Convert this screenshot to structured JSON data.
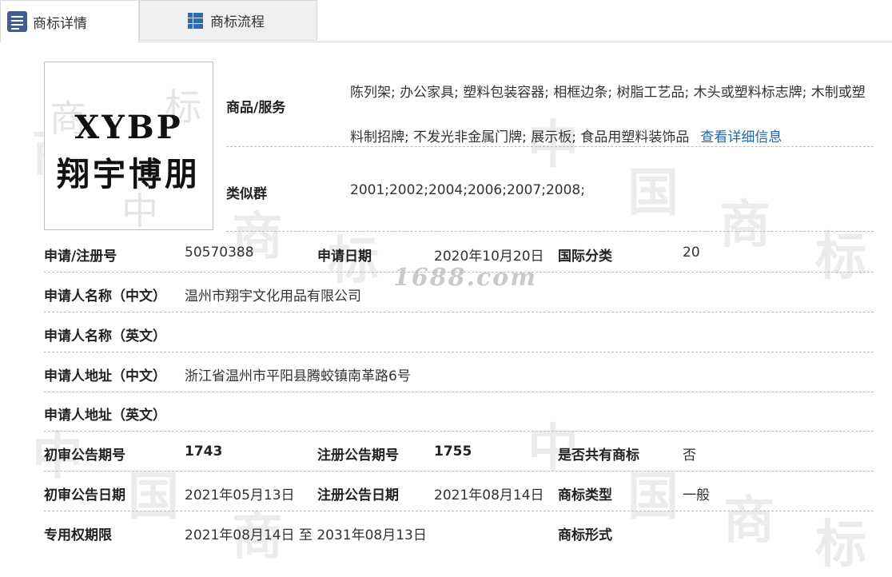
{
  "tabs": [
    {
      "label": "商标详情",
      "icon": "document-list-icon",
      "active": true
    },
    {
      "label": "商标流程",
      "icon": "grid-table-icon",
      "active": false
    }
  ],
  "logo": {
    "text_en": "XYBP",
    "text_cn": "翔宇博朋"
  },
  "watermark": {
    "center_text": "1688.com"
  },
  "goods": {
    "label": "商品/服务",
    "value": "陈列架; 办公家具; 塑料包装容器; 相框边条; 树脂工艺品; 木头或塑料标志牌; 木制或塑料制招牌; 不发光非金属门牌; 展示板; 食品用塑料装饰品",
    "link": "查看详细信息"
  },
  "similar_group": {
    "label": "类似群",
    "value": "2001;2002;2004;2006;2007;2008;"
  },
  "fields": {
    "reg_no": {
      "label": "申请/注册号",
      "value": "50570388"
    },
    "apply_date": {
      "label": "申请日期",
      "value": "2020年10月20日"
    },
    "intl_class": {
      "label": "国际分类",
      "value": "20"
    },
    "applicant_cn": {
      "label": "申请人名称（中文）",
      "value": "温州市翔宇文化用品有限公司"
    },
    "applicant_en": {
      "label": "申请人名称（英文）",
      "value": ""
    },
    "address_cn": {
      "label": "申请人地址（中文）",
      "value": "浙江省温州市平阳县腾蛟镇南革路6号"
    },
    "address_en": {
      "label": "申请人地址（英文）",
      "value": ""
    },
    "prelim_issue": {
      "label": "初审公告期号",
      "value": "1743"
    },
    "reg_issue": {
      "label": "注册公告期号",
      "value": "1755"
    },
    "shared": {
      "label": "是否共有商标",
      "value": "否"
    },
    "prelim_date": {
      "label": "初审公告日期",
      "value": "2021年05月13日"
    },
    "reg_date": {
      "label": "注册公告日期",
      "value": "2021年08月14日"
    },
    "tm_type": {
      "label": "商标类型",
      "value": "一般"
    },
    "exclusive_period": {
      "label": "专用权期限",
      "value": "2021年08月14日 至 2031年08月13日"
    },
    "tm_form": {
      "label": "商标形式",
      "value": ""
    }
  }
}
